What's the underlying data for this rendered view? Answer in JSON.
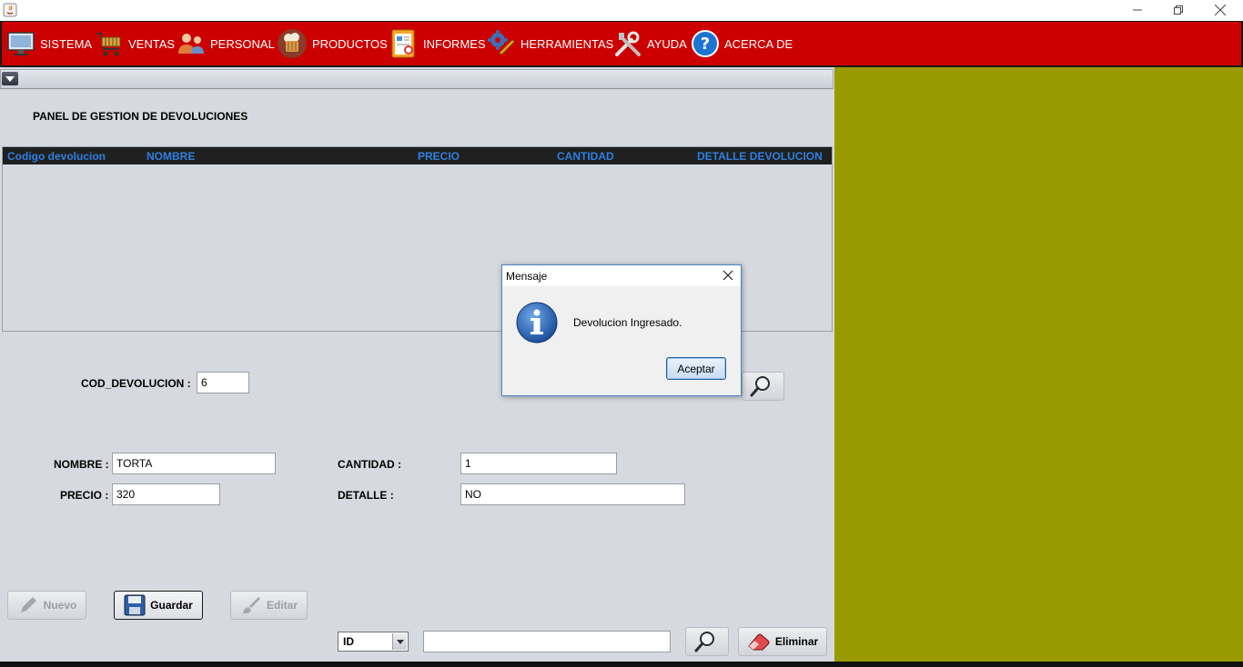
{
  "menu": {
    "items": [
      {
        "label": "SISTEMA",
        "icon": "monitor-icon"
      },
      {
        "label": "VENTAS",
        "icon": "shopping-cart-icon"
      },
      {
        "label": "PERSONAL",
        "icon": "users-icon"
      },
      {
        "label": "PRODUCTOS",
        "icon": "bakery-icon"
      },
      {
        "label": "INFORMES",
        "icon": "report-icon"
      },
      {
        "label": "HERRAMIENTAS",
        "icon": "gears-icon"
      },
      {
        "label": "AYUDA",
        "icon": "tools-icon"
      },
      {
        "label": "ACERCA DE",
        "icon": "question-icon"
      }
    ]
  },
  "panel": {
    "title": "PANEL DE GESTION DE DEVOLUCIONES",
    "table": {
      "columns": [
        "Codigo devolucion",
        "NOMBRE",
        "PRECIO",
        "CANTIDAD",
        "DETALLE DEVOLUCION"
      ],
      "rows": []
    },
    "form": {
      "cod_label": "COD_DEVOLUCION :",
      "cod_value": "6",
      "nombre_label": "NOMBRE :",
      "nombre_value": "TORTA",
      "precio_label": "PRECIO :",
      "precio_value": "320",
      "cantidad_label": "CANTIDAD :",
      "cantidad_value": "1",
      "detalle_label": "DETALLE :",
      "detalle_value": "NO"
    },
    "buttons": {
      "nuevo": "Nuevo",
      "guardar": "Guardar",
      "editar": "Editar",
      "eliminar": "Eliminar"
    },
    "search": {
      "select_value": "ID",
      "input_value": ""
    }
  },
  "dialog": {
    "title": "Mensaje",
    "message": "Devolucion Ingresado.",
    "ok_label": "Aceptar"
  },
  "colors": {
    "menubar": "#cc0000",
    "olive_area": "#999900",
    "table_header_text": "#2f7fe0"
  }
}
